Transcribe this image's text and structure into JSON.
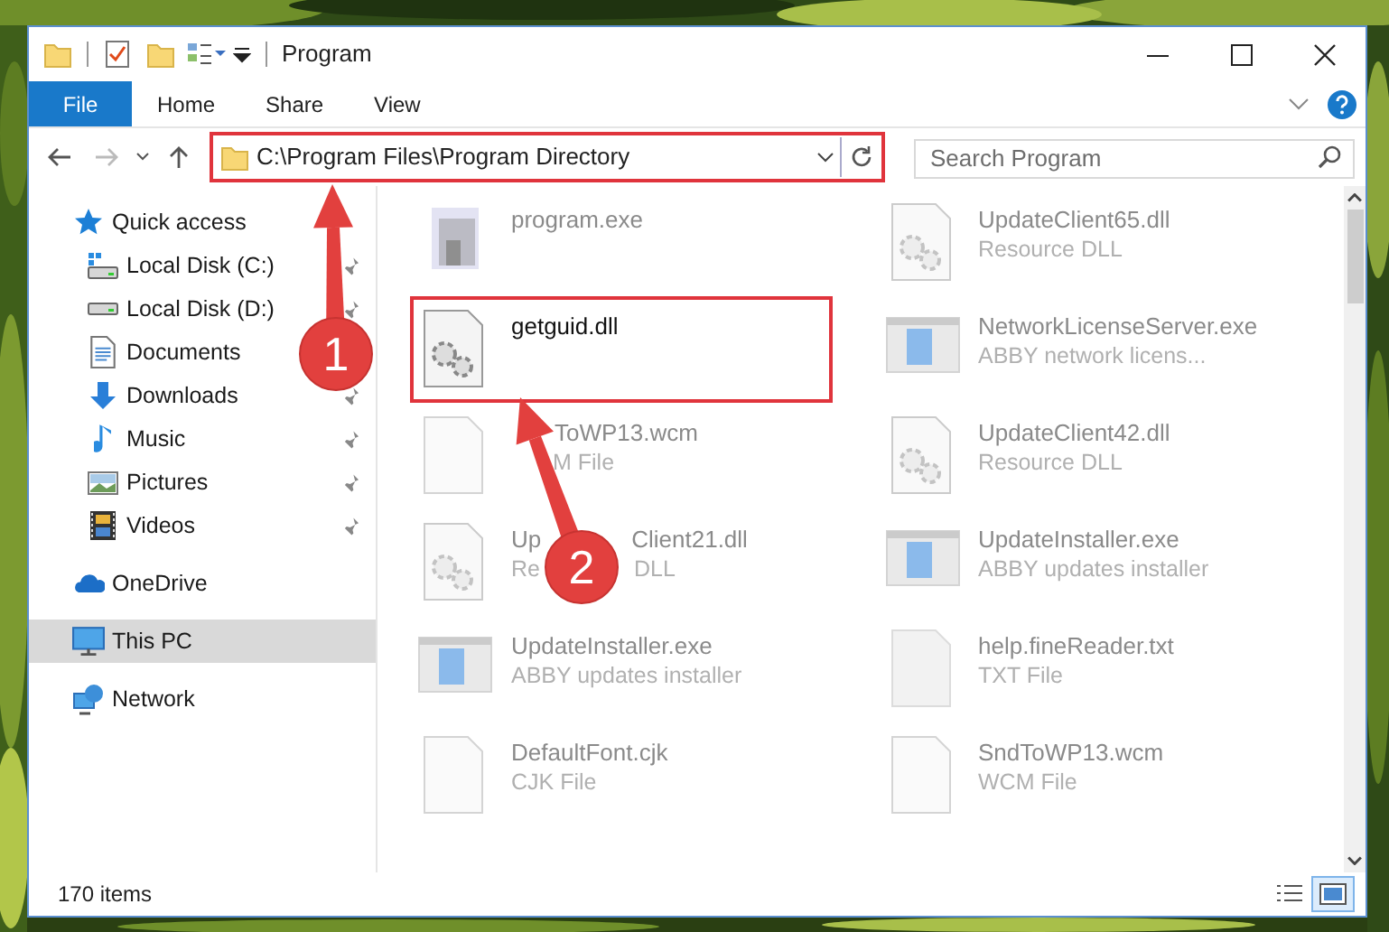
{
  "window": {
    "title": "Program"
  },
  "ribbon_tabs": [
    {
      "label": "File",
      "kind": "file"
    },
    {
      "label": "Home",
      "kind": "tab"
    },
    {
      "label": "Share",
      "kind": "tab"
    },
    {
      "label": "View",
      "kind": "tab"
    }
  ],
  "address": {
    "path": "C:\\Program Files\\Program Directory",
    "highlighted": true
  },
  "search": {
    "placeholder": "Search Program"
  },
  "nav": [
    {
      "label": "Quick access",
      "kind": "star",
      "selected": false,
      "children": [
        {
          "label": "Local Disk (C:)",
          "kind": "drive-c",
          "pinned": true
        },
        {
          "label": "Local Disk (D:)",
          "kind": "drive",
          "pinned": true
        },
        {
          "label": "Documents",
          "kind": "docs",
          "pinned": false
        },
        {
          "label": "Downloads",
          "kind": "downloads",
          "pinned": true
        },
        {
          "label": "Music",
          "kind": "music",
          "pinned": true
        },
        {
          "label": "Pictures",
          "kind": "pictures",
          "pinned": true
        },
        {
          "label": "Videos",
          "kind": "videos",
          "pinned": true
        }
      ]
    },
    {
      "label": "OneDrive",
      "kind": "cloud",
      "selected": false
    },
    {
      "label": "This PC",
      "kind": "pc",
      "selected": true
    },
    {
      "label": "Network",
      "kind": "network",
      "selected": false
    }
  ],
  "files": [
    {
      "name_parts": [
        "program.exe"
      ],
      "kind": "app",
      "highlighted": false
    },
    {
      "name_parts": [
        "UpdateClient65.dll"
      ],
      "type_parts": [
        "Resource DLL"
      ],
      "kind": "dll",
      "highlighted": false
    },
    {
      "name_parts": [
        "getguid.dll"
      ],
      "kind": "dll",
      "highlighted": true
    },
    {
      "name_parts": [
        "NetworkLicenseServer.exe"
      ],
      "type_parts": [
        "ABBY network licens..."
      ],
      "kind": "window",
      "highlighted": false
    },
    {
      "name_parts": [
        "ToWP13.wcm"
      ],
      "type_parts": [
        "M File"
      ],
      "kind": "blank",
      "highlighted": false
    },
    {
      "name_parts": [
        "UpdateClient42.dll"
      ],
      "type_parts": [
        "Resource DLL"
      ],
      "kind": "dll",
      "highlighted": false
    },
    {
      "name_parts": [
        "Up",
        "Client21.dll"
      ],
      "type_parts": [
        "Re",
        "DLL"
      ],
      "kind": "dll",
      "highlighted": false
    },
    {
      "name_parts": [
        "UpdateInstaller.exe"
      ],
      "type_parts": [
        "ABBY updates installer"
      ],
      "kind": "window",
      "highlighted": false
    },
    {
      "name_parts": [
        "UpdateInstaller.exe"
      ],
      "type_parts": [
        "ABBY updates installer"
      ],
      "kind": "window",
      "highlighted": false
    },
    {
      "name_parts": [
        "help.fineReader.txt"
      ],
      "type_parts": [
        "TXT File"
      ],
      "kind": "text",
      "highlighted": false
    },
    {
      "name_parts": [
        "DefaultFont.cjk"
      ],
      "type_parts": [
        "CJK File"
      ],
      "kind": "blank",
      "highlighted": false
    },
    {
      "name_parts": [
        "SndToWP13.wcm"
      ],
      "type_parts": [
        "WCM File"
      ],
      "kind": "blank",
      "highlighted": false
    }
  ],
  "annotations": [
    {
      "label": "1"
    },
    {
      "label": "2"
    }
  ],
  "status_bar": {
    "item_count": "170 items"
  },
  "view_buttons": [
    {
      "kind": "details",
      "selected": false
    },
    {
      "kind": "large",
      "selected": true
    }
  ]
}
